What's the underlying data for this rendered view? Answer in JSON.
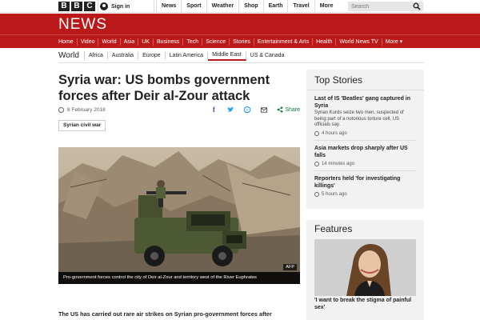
{
  "masthead": {
    "logo_letters": [
      "B",
      "B",
      "C"
    ],
    "signin_label": "Sign in",
    "nav": [
      "News",
      "Sport",
      "Weather",
      "Shop",
      "Earth",
      "Travel",
      "More"
    ],
    "search_placeholder": "Search"
  },
  "section_title": "NEWS",
  "main_nav": [
    "Home",
    "Video",
    "World",
    "Asia",
    "UK",
    "Business",
    "Tech",
    "Science",
    "Stories",
    "Entertainment & Arts",
    "Health",
    "World News TV",
    "More ▾"
  ],
  "sub_nav": {
    "section": "World",
    "items": [
      "Africa",
      "Australia",
      "Europe",
      "Latin America",
      "Middle East",
      "US & Canada"
    ],
    "active": "Middle East"
  },
  "article": {
    "headline": "Syria war: US bombs government forces after Deir al-Zour attack",
    "date": "8 February 2018",
    "share_label": "Share",
    "tag": "Syrian civil war",
    "photo_caption": "Pro-government forces control the city of Deir al-Zour and territory west of the River Euphrates",
    "photo_credit": "AFP",
    "intro": "The US has carried out rare air strikes on Syrian pro-government forces after"
  },
  "top_stories": {
    "title": "Top Stories",
    "items": [
      {
        "title": "Last of IS 'Beatles' gang captured in Syria",
        "summary": "Syrian Kurds seize two men, suspected of being part of a notorious torture cell, US officials say.",
        "time": "4 hours ago"
      },
      {
        "title": "Asia markets drop sharply after US falls",
        "summary": "",
        "time": "14 minutes ago"
      },
      {
        "title": "Reporters held 'for investigating killings'",
        "summary": "",
        "time": "5 hours ago"
      }
    ]
  },
  "features": {
    "title": "Features",
    "item_title": "'I want to break the stigma of painful sex'"
  },
  "colors": {
    "brand_red": "#bb1919",
    "share_green": "#117a3d",
    "panel_grey": "#f2f2f2"
  }
}
